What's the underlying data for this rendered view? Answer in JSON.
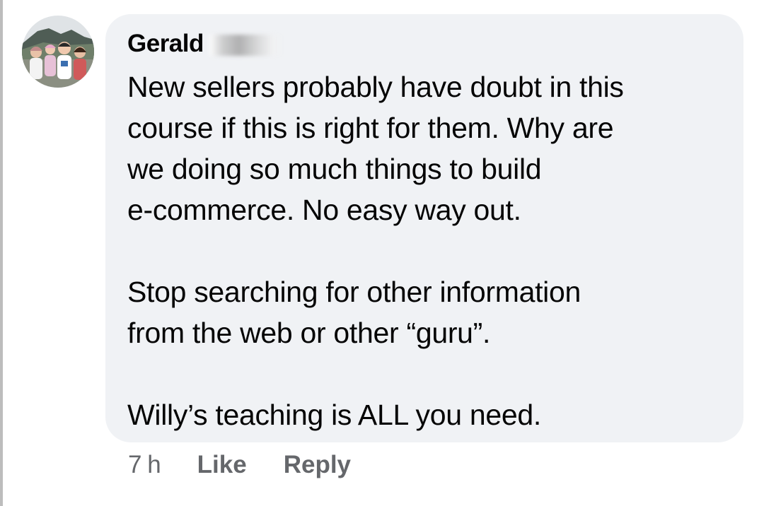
{
  "comment": {
    "author": "Gerald",
    "paragraphs": [
      "New sellers probably have doubt in this\ncourse if this is right for them. Why are\nwe doing so much things to build\ne-commerce. No easy way out.",
      "Stop searching for other information\nfrom the web or other “guru”.",
      "Willy’s teaching is ALL you need."
    ]
  },
  "actions": {
    "timestamp": "7 h",
    "like_label": "Like",
    "reply_label": "Reply"
  },
  "colors": {
    "bubble": "#f0f2f5",
    "text": "#050505",
    "secondary_text": "#65676b"
  },
  "icons": {
    "avatar": "family-photo-avatar"
  }
}
